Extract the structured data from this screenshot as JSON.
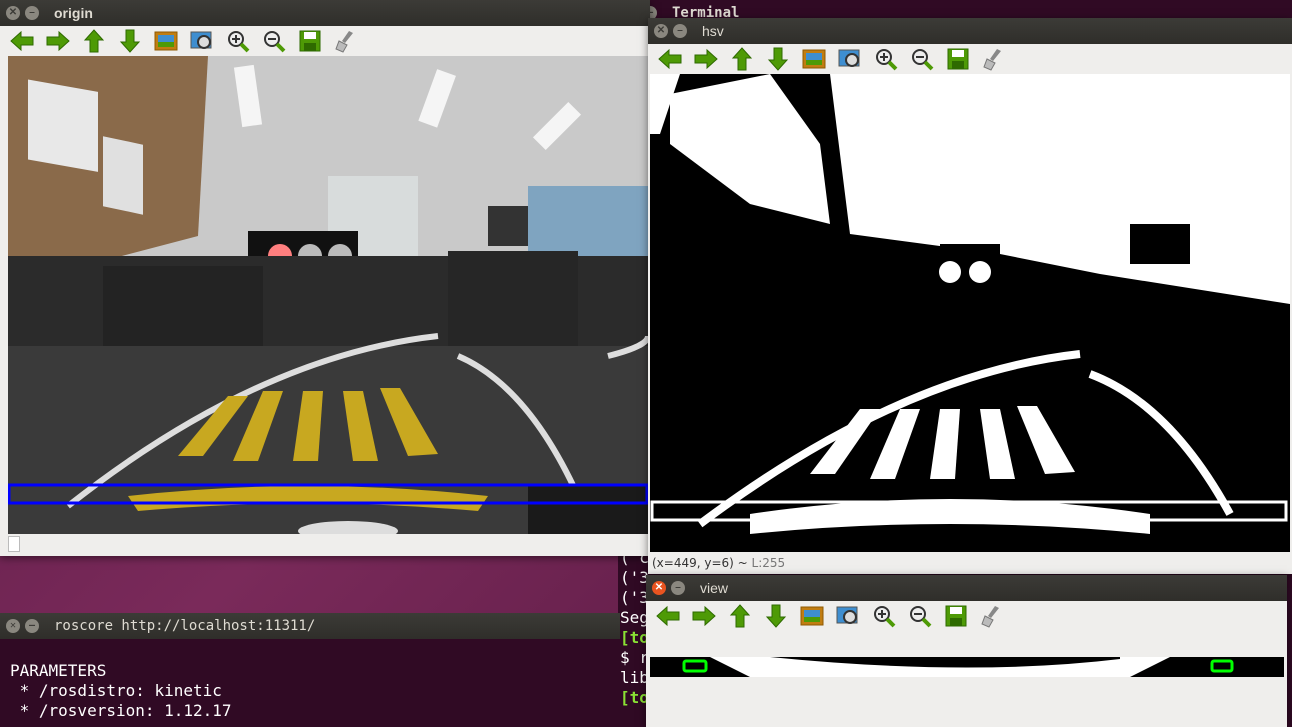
{
  "windows": {
    "origin": {
      "title": "origin"
    },
    "hsv": {
      "title": "hsv",
      "status": "(x=449, y=6) ~ ",
      "status_value": "L:255"
    },
    "view": {
      "title": "view"
    },
    "terminal": {
      "title": "Terminal"
    },
    "roscore": {
      "title": "roscore http://localhost:11311/"
    }
  },
  "toolbar_icons": [
    "pan-left-icon",
    "pan-right-icon",
    "pan-up-icon",
    "pan-down-icon",
    "zoom-fit-icon",
    "zoom-original-icon",
    "zoom-in-icon",
    "zoom-out-icon",
    "save-icon",
    "properties-icon"
  ],
  "roscore_lines": [
    "PARAMETERS",
    " * /rosdistro: kinetic",
    " * /rosversion: 1.12.17"
  ],
  "terminal_lines": [
    "('c",
    "('3",
    "('3",
    "Seg",
    "$ r",
    "lib"
  ],
  "terminal_prompt_fragment": "[to",
  "colors": {
    "roi_box": "#0000ff",
    "lane_marker": "#00ff00",
    "terminal_bg": "#300a24",
    "close_active": "#e95420"
  }
}
